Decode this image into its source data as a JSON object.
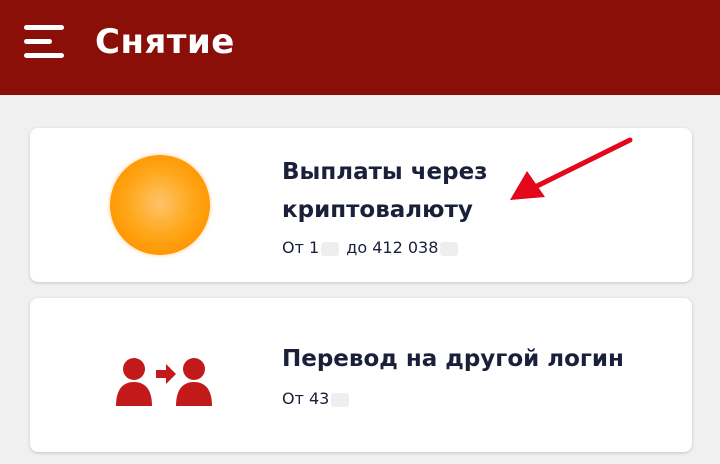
{
  "header": {
    "title": "Снятие",
    "menu_icon": "hamburger-icon",
    "background_color": "#8a0f08"
  },
  "options": [
    {
      "icon": "crypto-coin-icon",
      "title": "Выплаты через криптовалюту",
      "limit_from_label": "От 1",
      "limit_to_label": "до 412 038"
    },
    {
      "icon": "user-transfer-icon",
      "title": "Перевод на другой логин",
      "limit_from_label": "От 43"
    }
  ],
  "annotation": {
    "icon": "red-arrow-icon",
    "color": "#e3071b"
  }
}
